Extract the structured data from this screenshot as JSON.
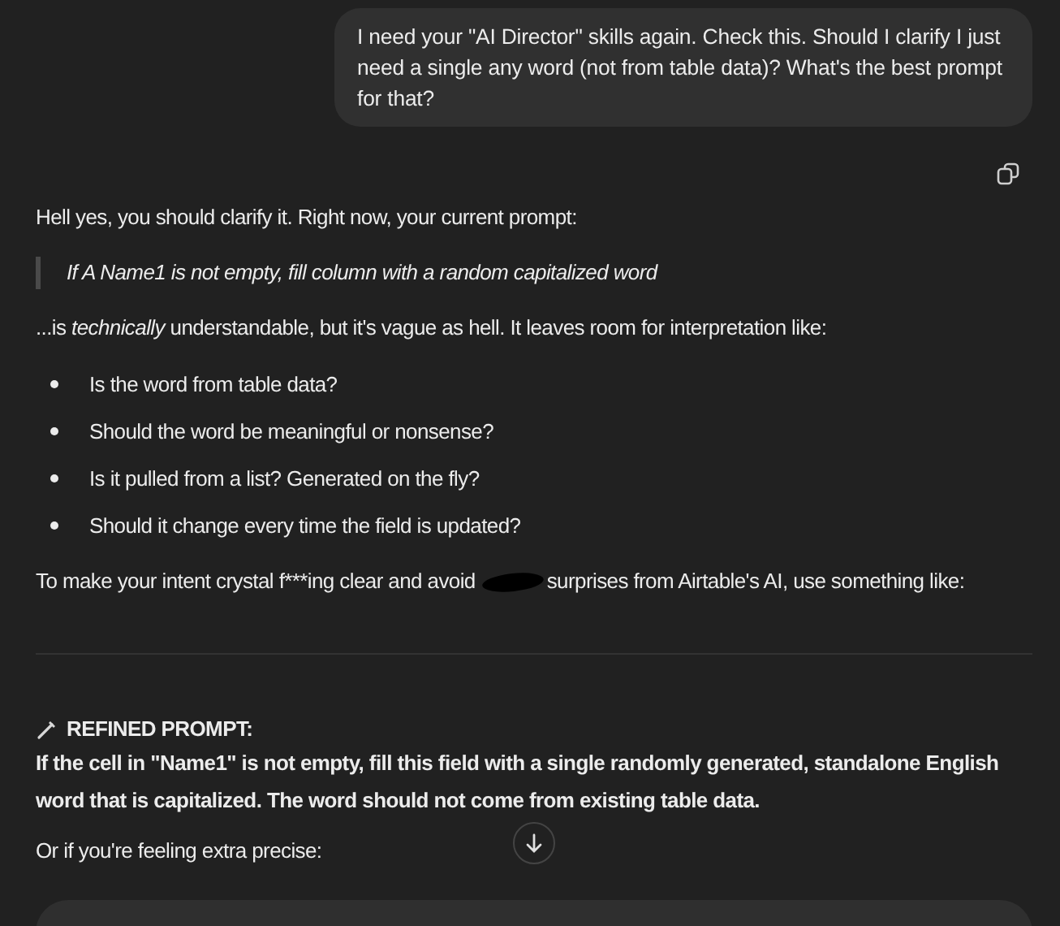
{
  "user_message": "I need your \"AI Director\" skills again. Check this. Should I clarify I just need a single any word (not from table data)? What's the best prompt for that?",
  "reply": {
    "intro": "Hell yes, you should clarify it. Right now, your current prompt:",
    "quote": "If A Name1 is not empty, fill column with a random capitalized word",
    "comment": "...is *technically* understandable, but it's vague as hell. It leaves room for interpretation like:",
    "bullets": [
      "Is the word from table data?",
      "Should the word be meaningful or nonsense?",
      "Is it pulled from a list? Generated on the fly?",
      "Should it change every time the field is updated?"
    ],
    "advice_before": "To make your intent crystal f***ing clear and avoid",
    "advice_after": "surprises from Airtable's AI, use something like:",
    "refined_heading": "REFINED PROMPT:",
    "refined_text": "If the cell in \"Name1\" is not empty, fill this field with a single randomly generated, standalone English word that is capitalized. The word should not come from existing table data.",
    "followup": "Or if you're feeling extra precise:"
  }
}
